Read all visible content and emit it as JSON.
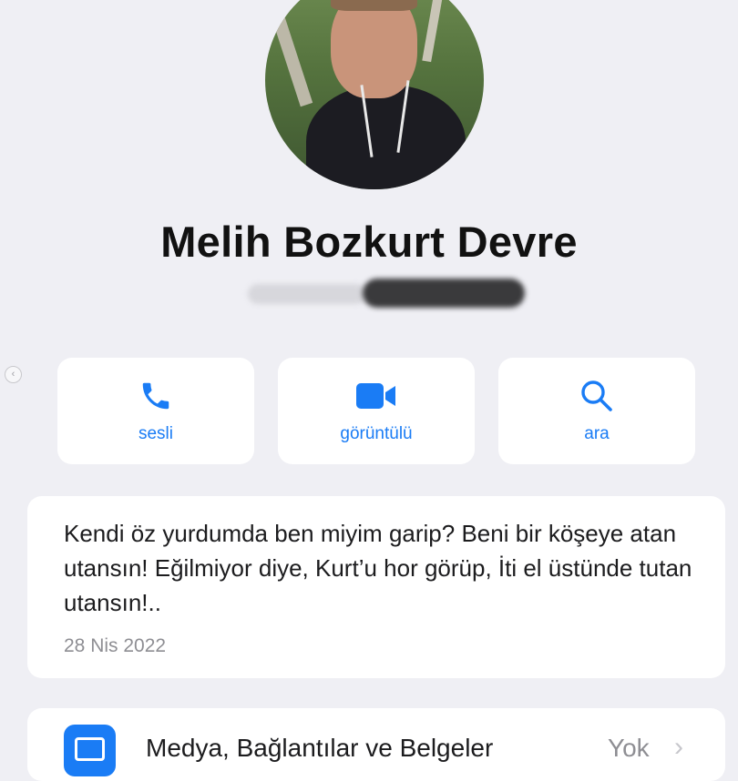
{
  "contact": {
    "name": "Melih Bozkurt Devre"
  },
  "actions": [
    {
      "label": "sesli",
      "icon": "phone-icon"
    },
    {
      "label": "görüntülü",
      "icon": "video-camera-icon"
    },
    {
      "label": "ara",
      "icon": "search-icon"
    }
  ],
  "about": {
    "text": "Kendi öz yurdumda ben miyim garip?  Beni bir köşeye atan utansın! Eğilmiyor diye, Kurt’u hor görüp, İti el üstünde tutan utansın!..",
    "date": "28 Nis 2022"
  },
  "media": {
    "label": "Medya, Bağlantılar ve Belgeler",
    "value": "Yok",
    "icon": "photo-icon"
  },
  "navigation": {
    "back_icon": "chevron-left-icon",
    "back_glyph": "‹"
  },
  "colors": {
    "accent": "#1a7cf5",
    "background": "#efeff4"
  }
}
